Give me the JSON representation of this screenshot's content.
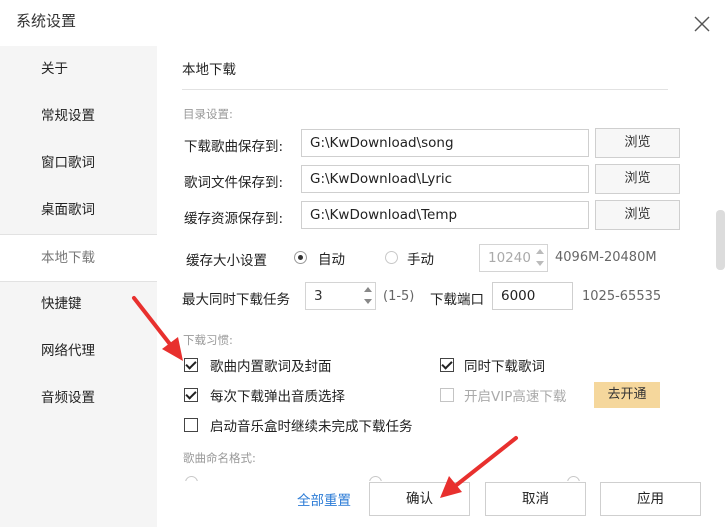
{
  "window": {
    "title": "系统设置",
    "close_icon": "close-icon"
  },
  "sidebar": {
    "items": [
      {
        "label": "关于"
      },
      {
        "label": "常规设置"
      },
      {
        "label": "窗口歌词"
      },
      {
        "label": "桌面歌词"
      },
      {
        "label": "本地下载",
        "active": true
      },
      {
        "label": "快捷键"
      },
      {
        "label": "网络代理"
      },
      {
        "label": "音频设置"
      }
    ]
  },
  "section": {
    "title": "本地下载",
    "directories": {
      "group_label": "目录设置:",
      "rows": [
        {
          "label": "下载歌曲保存到:",
          "value": "G:\\KwDownload\\song",
          "button": "浏览"
        },
        {
          "label": "歌词文件保存到:",
          "value": "G:\\KwDownload\\Lyric",
          "button": "浏览"
        },
        {
          "label": "缓存资源保存到:",
          "value": "G:\\KwDownload\\Temp",
          "button": "浏览"
        }
      ]
    },
    "cache": {
      "label": "缓存大小设置",
      "auto_label": "自动",
      "manual_label": "手动",
      "selected": "自动",
      "size_value": "10240",
      "range": "4096M-20480M"
    },
    "max_tasks": {
      "label": "最大同时下载任务",
      "value": "3",
      "range": "(1-5)"
    },
    "port": {
      "label": "下载端口",
      "value": "6000",
      "range": "1025-65535"
    },
    "habits": {
      "group_label": "下载习惯:",
      "options": [
        {
          "label": "歌曲内置歌词及封面",
          "checked": true,
          "enabled": true
        },
        {
          "label": "同时下载歌词",
          "checked": true,
          "enabled": true
        },
        {
          "label": "每次下载弹出音质选择",
          "checked": true,
          "enabled": true
        },
        {
          "label": "开启VIP高速下载",
          "checked": false,
          "enabled": false
        },
        {
          "label": "启动音乐盒时继续未完成下载任务",
          "checked": false,
          "enabled": true
        }
      ],
      "vip_button": "去开通"
    },
    "naming": {
      "group_label": "歌曲命名格式:"
    }
  },
  "footer": {
    "reset_label": "全部重置",
    "confirm_label": "确认",
    "cancel_label": "取消",
    "apply_label": "应用"
  },
  "colors": {
    "accent_link": "#2b7bd6",
    "vip_button": "#f5d79c",
    "annotation_arrow": "#e8302e"
  }
}
